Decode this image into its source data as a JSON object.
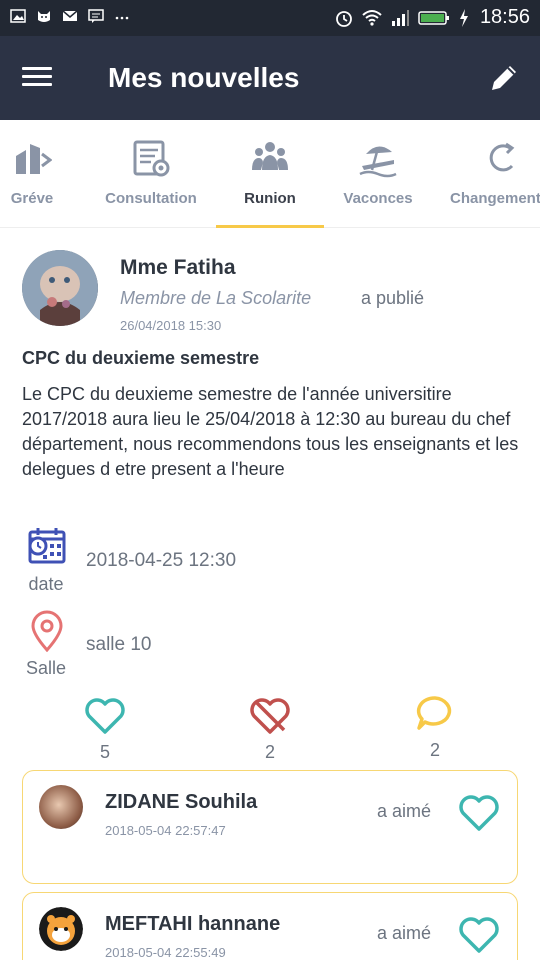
{
  "status_bar": {
    "time": "18:56"
  },
  "app_bar": {
    "title": "Mes nouvelles"
  },
  "tabs": [
    {
      "label": "Gréve",
      "icon": "strike-icon"
    },
    {
      "label": "Consultation",
      "icon": "consultation-icon"
    },
    {
      "label": "Runion",
      "icon": "meeting-icon",
      "active": true
    },
    {
      "label": "Vaconces",
      "icon": "vacation-icon"
    },
    {
      "label": "Changement",
      "icon": "change-icon"
    }
  ],
  "post": {
    "author": "Mme Fatiha",
    "role": "Membre de La Scolarite",
    "action": "a publié",
    "date": "26/04/2018 15:30",
    "title": "CPC du deuxieme semestre",
    "body": "Le CPC du deuxieme semestre de l'année universitire 2017/2018 aura lieu le 25/04/2018 à 12:30 au bureau du chef département, nous recommendons tous les enseignants et les delegues d etre present a l'heure",
    "date_label": "date",
    "date_value": "2018-04-25 12:30",
    "place_label": "Salle",
    "place_value": "salle 10",
    "likes": "5",
    "dislikes": "2",
    "comments": "2"
  },
  "activity": [
    {
      "name": "ZIDANE Souhila",
      "date": "2018-05-04 22:57:47",
      "action": "a aimé"
    },
    {
      "name": "MEFTAHI hannane",
      "date": "2018-05-04 22:55:49",
      "action": "a aimé"
    }
  ],
  "colors": {
    "app_bar": "#2c3345",
    "status_bar": "#222833",
    "accent": "#f7c948",
    "like": "#3db6b0",
    "dislike": "#c0504d",
    "comment": "#f7c948",
    "calendar_icon": "#3f51b5",
    "location_icon": "#e57373"
  }
}
